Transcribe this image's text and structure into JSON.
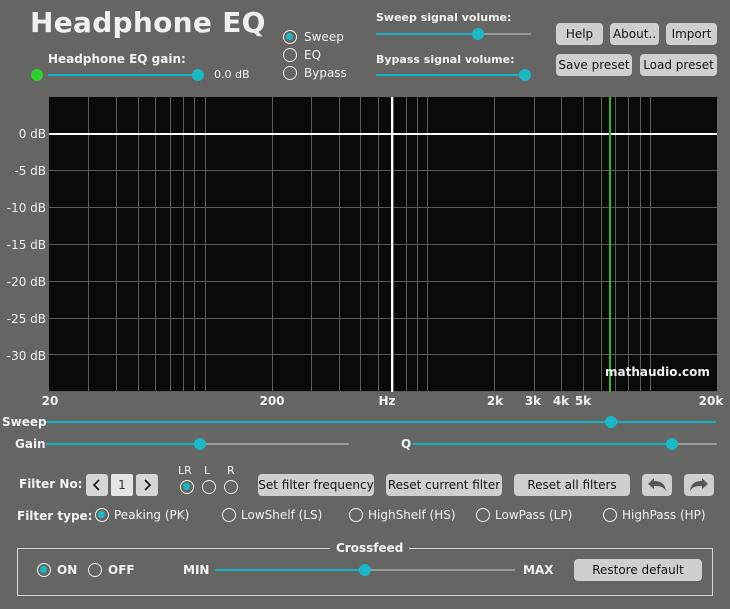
{
  "header": {
    "title": "Headphone EQ"
  },
  "gain": {
    "label": "Headphone EQ gain:",
    "value": "0.0 dB"
  },
  "mode": {
    "options": [
      "Sweep",
      "EQ",
      "Bypass"
    ],
    "selected": "Sweep"
  },
  "sweep_volume": {
    "label": "Sweep signal volume:",
    "level_fraction": 0.66
  },
  "bypass_volume": {
    "label": "Bypass signal volume:",
    "level_fraction": 1.0
  },
  "toolbar": {
    "help": "Help",
    "about": "About..",
    "import": "Import",
    "save_preset": "Save preset",
    "load_preset": "Load preset"
  },
  "plot": {
    "y_ticks": [
      "0 dB",
      "-5 dB",
      "-10 dB",
      "-15 dB",
      "-20 dB",
      "-25 dB",
      "-30 dB"
    ],
    "x_ticks": [
      "20",
      "200",
      "Hz",
      "2k",
      "3k",
      "4k",
      "5k",
      "20k"
    ],
    "watermark": "mathaudio.com",
    "colors": {
      "background": "#0a0b09",
      "curve": "#ffffff",
      "marker": "#2fb52f",
      "grid": "#5e5e5b"
    }
  },
  "sweep": {
    "label": "Sweep",
    "position_fraction": 0.845
  },
  "gain_slider": {
    "label": "Gain",
    "position_fraction": 0.5
  },
  "q_slider": {
    "label": "Q",
    "position_fraction": 0.85
  },
  "filter": {
    "label": "Filter No:",
    "number": "1",
    "channels": [
      "LR",
      "L",
      "R"
    ],
    "selected_channel": "LR",
    "set_frequency": "Set filter frequency",
    "reset_current": "Reset current filter",
    "reset_all": "Reset all filters"
  },
  "filter_type": {
    "label": "Filter type:",
    "options": [
      "Peaking (PK)",
      "LowShelf (LS)",
      "HighShelf (HS)",
      "LowPass (LP)",
      "HighPass (HP)"
    ],
    "selected": "Peaking (PK)"
  },
  "crossfeed": {
    "title": "Crossfeed",
    "on": "ON",
    "off": "OFF",
    "selected": "ON",
    "min": "MIN",
    "max": "MAX",
    "level_fraction": 0.5,
    "restore": "Restore default"
  },
  "accent_color": "#1ab9c8"
}
